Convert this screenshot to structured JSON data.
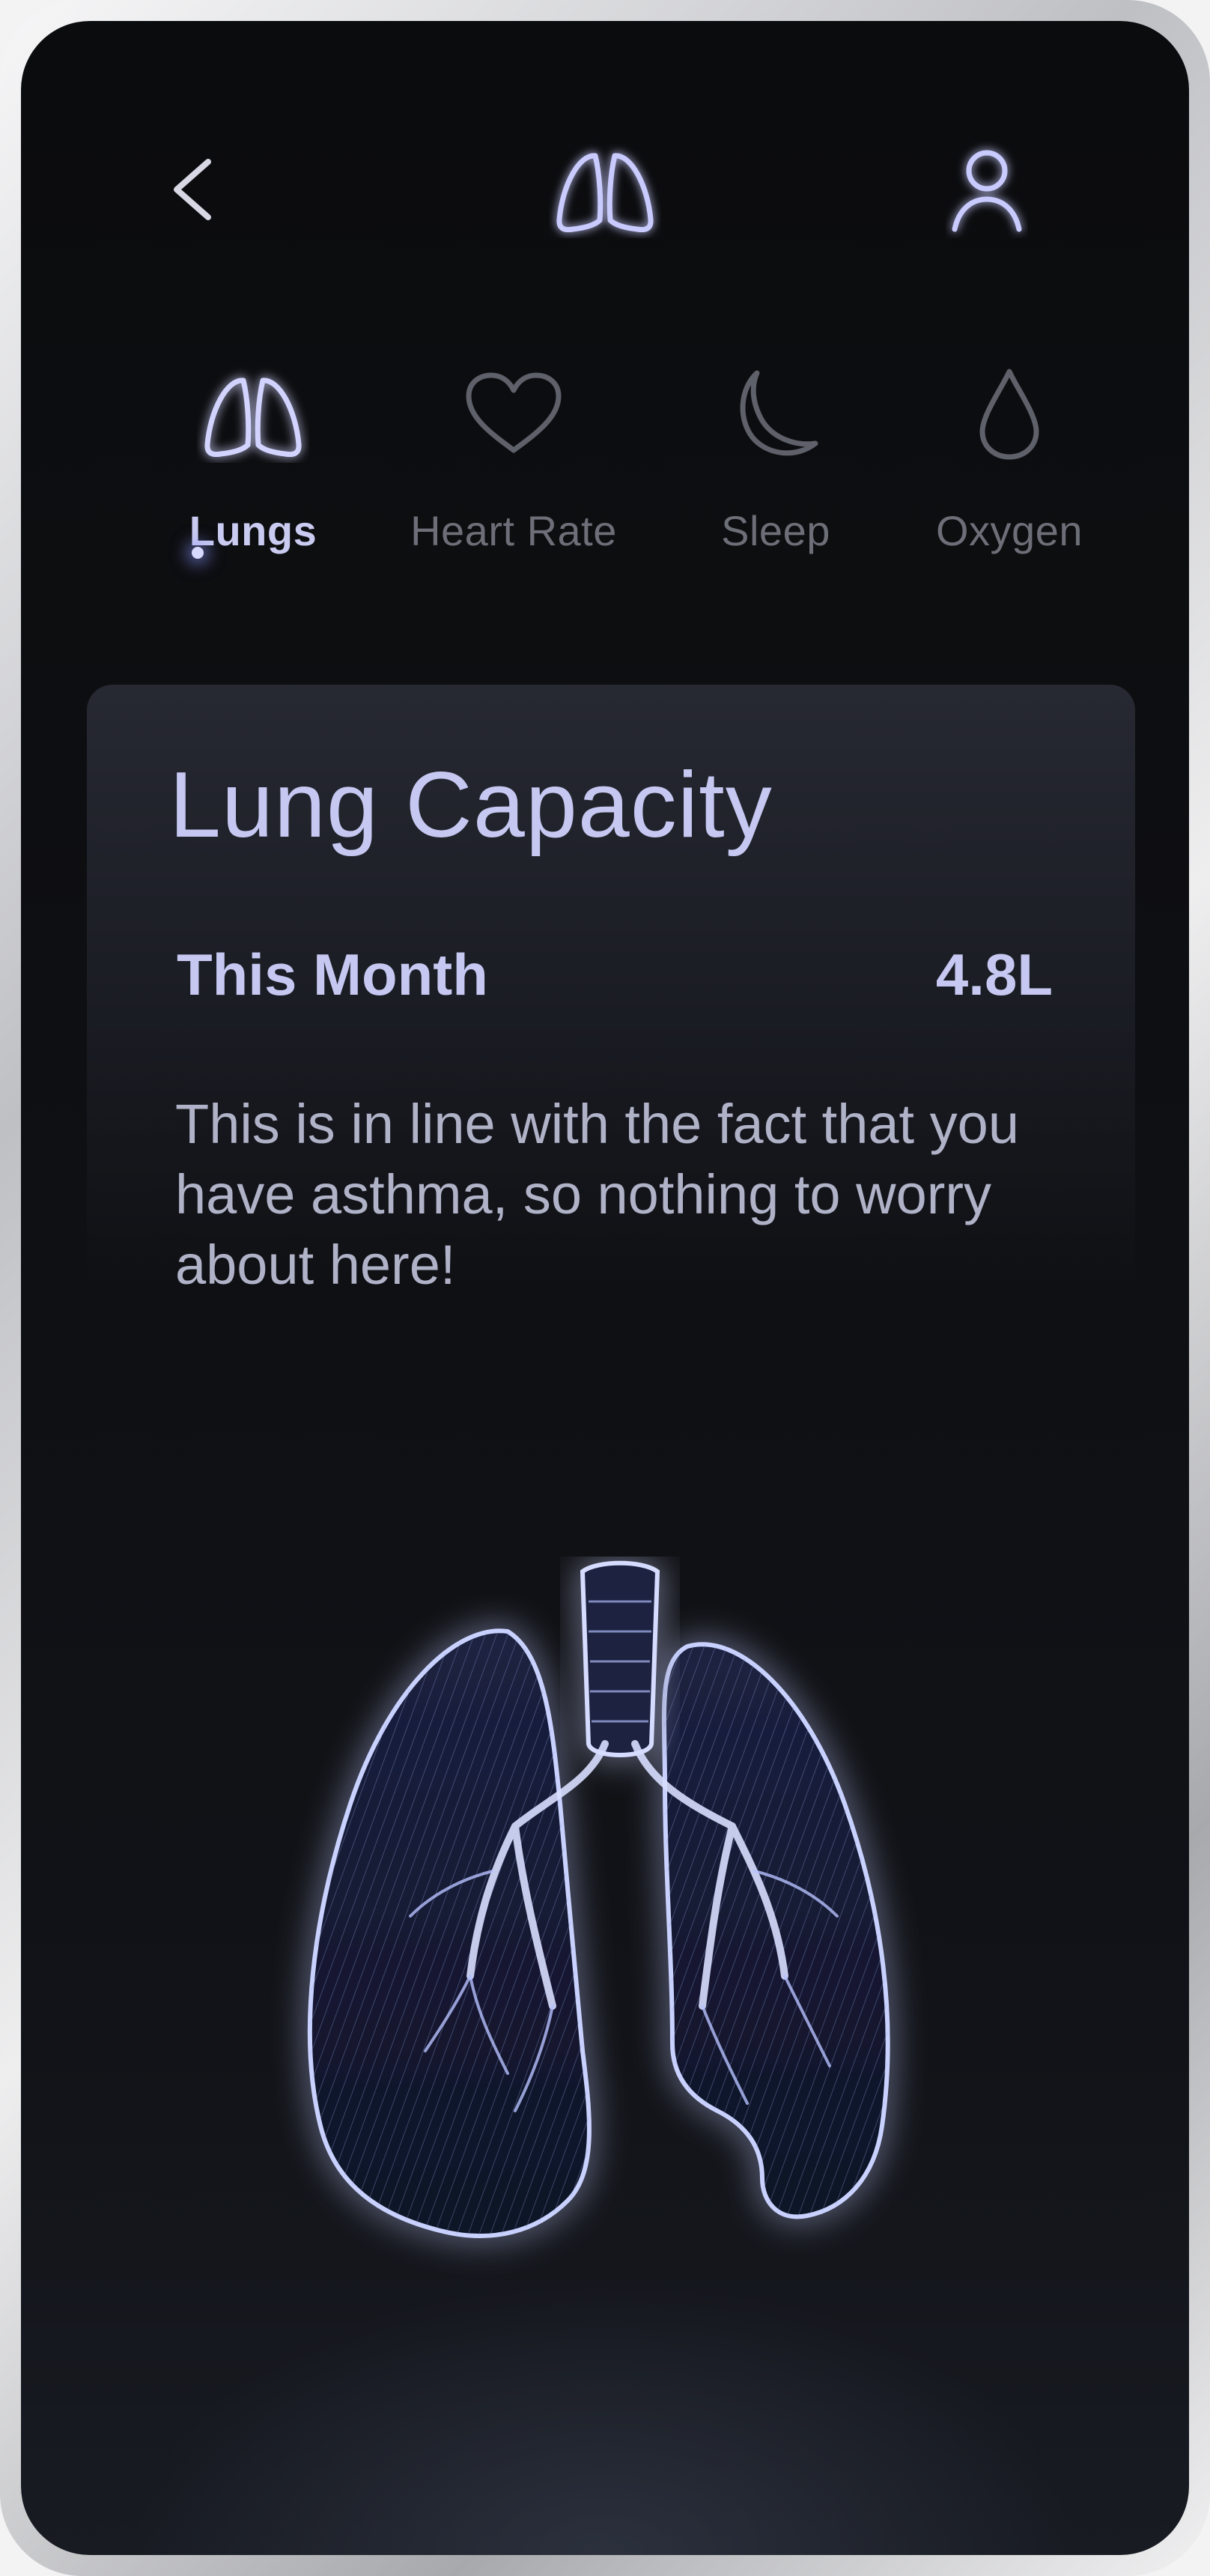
{
  "header": {
    "back_icon": "chevron-left-icon",
    "logo_icon": "lungs-icon",
    "profile_icon": "user-icon"
  },
  "tabs": [
    {
      "label": "Lungs",
      "icon": "lungs-icon",
      "active": true
    },
    {
      "label": "Heart Rate",
      "icon": "heart-icon",
      "active": false
    },
    {
      "label": "Sleep",
      "icon": "moon-icon",
      "active": false
    },
    {
      "label": "Oxygen",
      "icon": "drop-icon",
      "active": false
    }
  ],
  "card": {
    "title": "Lung Capacity",
    "row_label": "This Month",
    "row_value": "4.8L",
    "description": "This is in line with the fact that you have asthma, so nothing to worry about here!"
  },
  "illustration": {
    "icon": "lungs-xray-illustration"
  },
  "colors": {
    "background": "#0e0f12",
    "accent": "#c6c8f2",
    "glow": "#7f8cff",
    "inactive": "#6d6f78"
  }
}
